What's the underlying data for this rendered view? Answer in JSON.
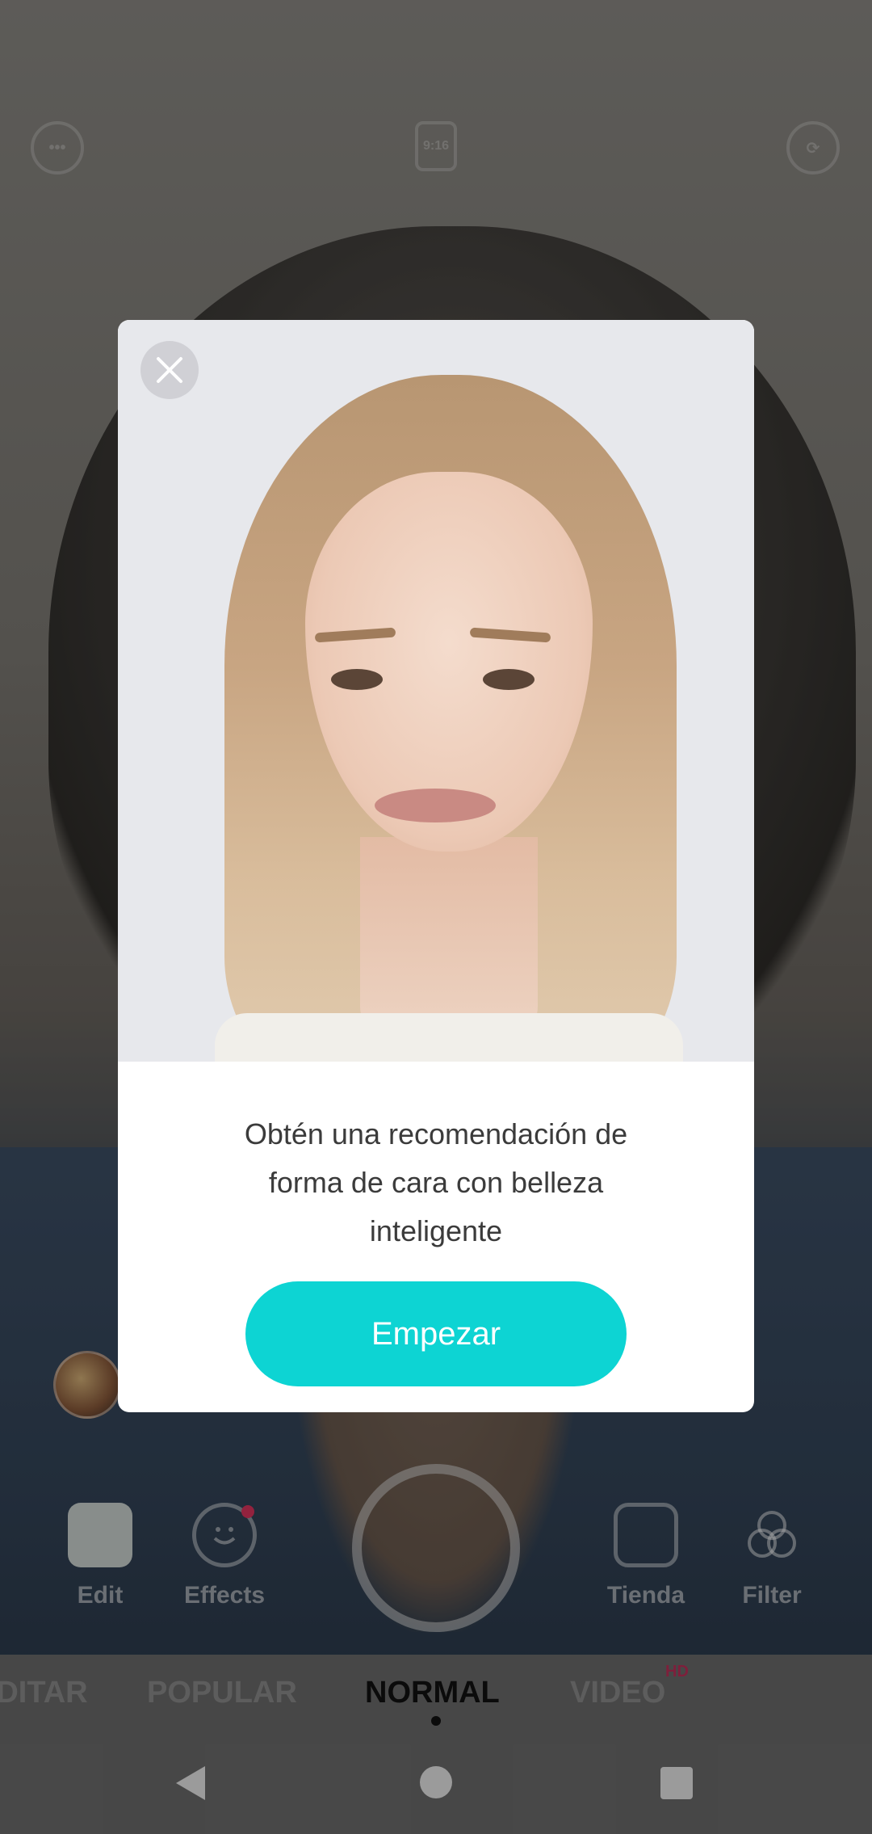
{
  "top_bar": {
    "more_icon": "more-icon",
    "ratio_label": "9:16",
    "switch_camera_icon": "switch-camera-icon"
  },
  "dialog": {
    "close_icon": "close-icon",
    "message": "Obtén una recomendación de forma de cara con belleza inteligente",
    "start_label": "Empezar",
    "accent_color": "#0dd4d3"
  },
  "tools": {
    "edit": "Edit",
    "effects": "Effects",
    "store": "Tienda",
    "filter": "Filter"
  },
  "modes": {
    "editar": "EDITAR",
    "popular": "POPULAR",
    "normal": "NORMAL",
    "video": "VIDEO",
    "hd_badge": "HD"
  },
  "nav": {
    "back_icon": "back-icon",
    "home_icon": "home-icon",
    "recents_icon": "recents-icon"
  }
}
